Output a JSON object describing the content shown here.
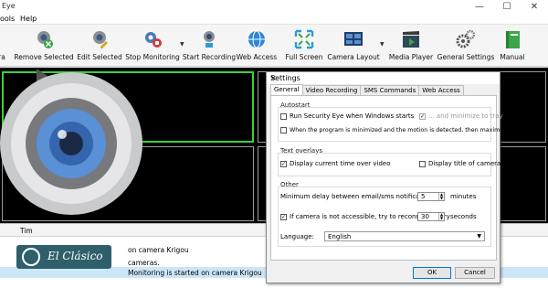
{
  "window": {
    "title": "Eye"
  },
  "menu": {
    "items": [
      "ools",
      "Help"
    ]
  },
  "toolbar": {
    "buttons": [
      {
        "label": "ra",
        "icon": "camera-icon"
      },
      {
        "label": "Remove Selected",
        "icon": "remove-camera-icon"
      },
      {
        "label": "Edit Selected",
        "icon": "edit-camera-icon"
      },
      {
        "label": "Stop Monitoring",
        "icon": "stop-monitoring-icon"
      },
      {
        "label": "Start Recording",
        "icon": "record-icon"
      },
      {
        "label": "Web Access",
        "icon": "globe-icon"
      },
      {
        "label": "Full Screen",
        "icon": "fullscreen-icon"
      },
      {
        "label": "Camera Layout",
        "icon": "layout-icon"
      },
      {
        "label": "Media Player",
        "icon": "clapperboard-icon"
      },
      {
        "label": "General Settings",
        "icon": "gears-icon"
      },
      {
        "label": "Manual",
        "icon": "book-icon"
      }
    ]
  },
  "log": {
    "header": "Tim",
    "rows": [
      {
        "text": "on camera Krigou"
      },
      {
        "text": "cameras."
      },
      {
        "text": "Monitoring is started on camera Krigou"
      }
    ]
  },
  "badge": {
    "text": "El Clásico"
  },
  "dialog": {
    "title": "Settings",
    "tabs": [
      "General",
      "Video Recording",
      "SMS Commands",
      "Web Access"
    ],
    "autostart": {
      "title": "Autostart",
      "run_on_start": "Run Security Eye when Windows starts",
      "minimize_tray": "... and minimize to tray",
      "maximize_motion": "When the program is minimized and the motion is detected, then maximize the program"
    },
    "overlays": {
      "title": "Text overlays",
      "display_time": "Display current time over video",
      "display_title": "Display title of camera"
    },
    "other": {
      "title": "Other",
      "min_delay_label": "Minimum delay between email/sms notifications",
      "min_delay_value": "5",
      "min_delay_unit": "minutes",
      "reconnect_label": "If camera is not accessible, try to reconnect every",
      "reconnect_value": "30",
      "reconnect_unit": "seconds",
      "language_label": "Language:",
      "language_value": "English"
    },
    "ok": "OK",
    "cancel": "Cancel"
  },
  "colors": {
    "accent_green": "#3ad23a",
    "selected_row": "#cde6f7",
    "dialog_default_border": "#0078d7"
  }
}
